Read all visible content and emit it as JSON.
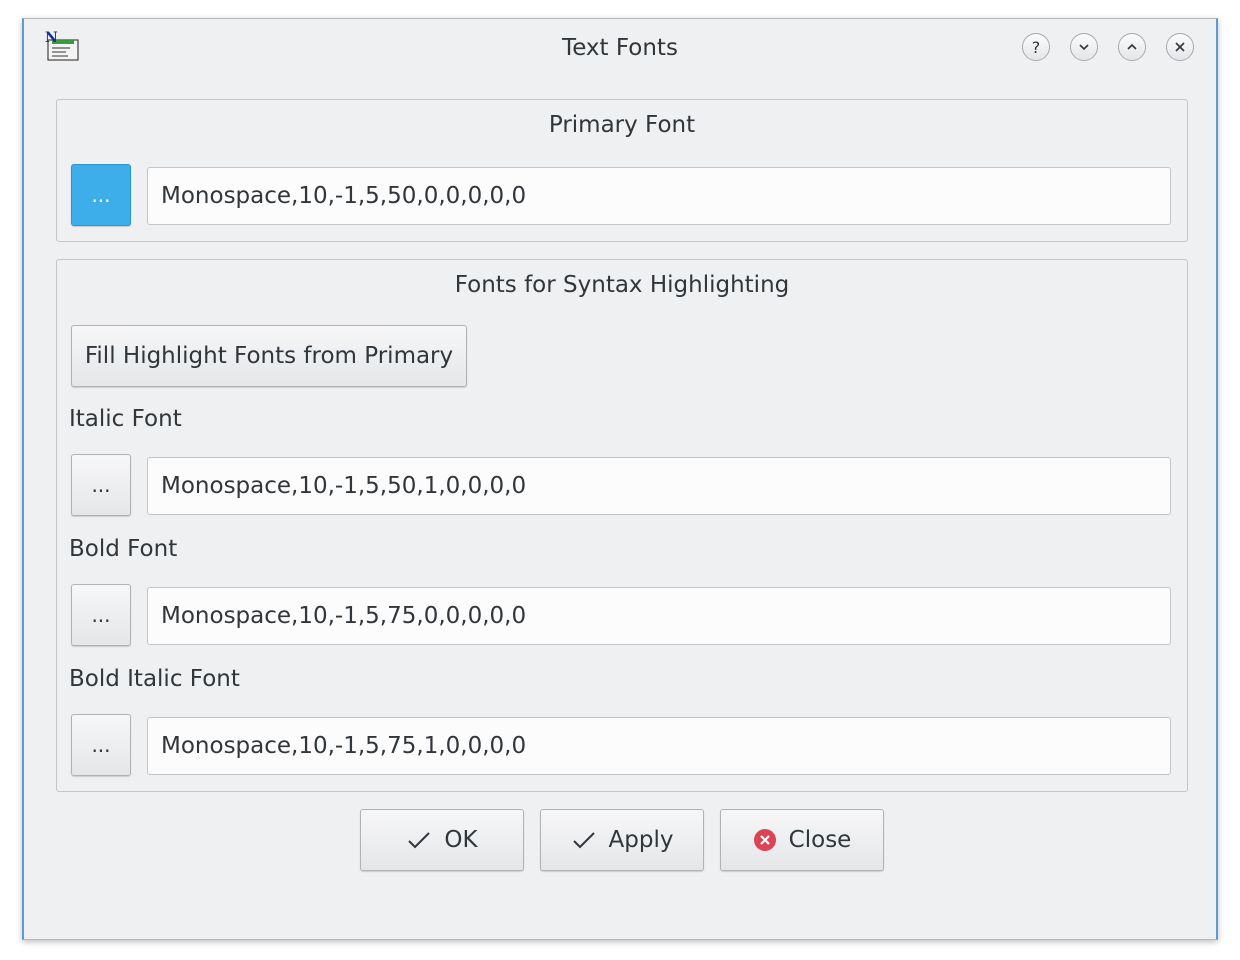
{
  "window": {
    "title": "Text Fonts",
    "controls": {
      "help_glyph": "?",
      "minimize_glyph": "⌄",
      "maximize_glyph": "⌃",
      "close_glyph": "✕"
    }
  },
  "primary_group": {
    "title": "Primary Font",
    "choose_label": "...",
    "font_value": "Monospace,10,-1,5,50,0,0,0,0,0"
  },
  "syntax_group": {
    "title": "Fonts for Syntax Highlighting",
    "fill_button_label": "Fill Highlight Fonts from Primary",
    "italic": {
      "label": "Italic Font",
      "choose_label": "...",
      "font_value": "Monospace,10,-1,5,50,1,0,0,0,0"
    },
    "bold": {
      "label": "Bold Font",
      "choose_label": "...",
      "font_value": "Monospace,10,-1,5,75,0,0,0,0,0"
    },
    "bold_italic": {
      "label": "Bold Italic Font",
      "choose_label": "...",
      "font_value": "Monospace,10,-1,5,75,1,0,0,0,0"
    }
  },
  "buttons": {
    "ok_label": "OK",
    "apply_label": "Apply",
    "close_label": "Close"
  },
  "colors": {
    "accent": "#3daee9",
    "close_icon": "#da4453"
  },
  "icons": {
    "app": "nedit-app-icon",
    "ok": "checkmark-icon",
    "apply": "checkmark-icon",
    "close": "close-circle-icon"
  }
}
